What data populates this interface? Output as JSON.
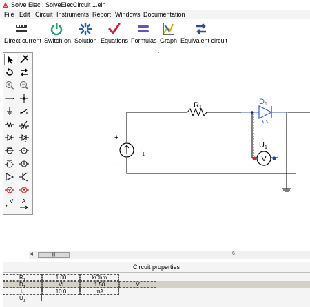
{
  "window": {
    "title": "Solve Elec : SolveElecCircuit 1.eln"
  },
  "menu": [
    "File",
    "Edit",
    "Circuit",
    "Instruments",
    "Report",
    "Windows",
    "Documentation"
  ],
  "toolbar": [
    {
      "label": "Direct current",
      "icon": "battery-icon"
    },
    {
      "label": "Switch on",
      "icon": "power-icon"
    },
    {
      "label": "Solution",
      "icon": "spark-icon"
    },
    {
      "label": "Equations",
      "icon": "check-icon"
    },
    {
      "label": "Formulas",
      "icon": "equals-icon"
    },
    {
      "label": "Graph",
      "icon": "graph-icon"
    },
    {
      "label": "Equivalent circuit",
      "icon": "equivalent-icon"
    }
  ],
  "circuit": {
    "resistor": {
      "name": "R",
      "sub": "1"
    },
    "diode": {
      "name": "D",
      "sub": "1"
    },
    "voltmeter": {
      "name": "U",
      "sub": "1",
      "symbol": "V"
    },
    "source": {
      "name": "I",
      "sub": "1",
      "plus": "+",
      "minus": "−"
    }
  },
  "palette_labels": {
    "voltage": "V",
    "current": "A"
  },
  "properties": {
    "title": "Circuit properties",
    "rows": [
      {
        "name": "R",
        "sub": "1",
        "value": "1.00",
        "unit": "kOhm",
        "extra": "",
        "extra2": ""
      },
      {
        "name": "D",
        "sub": "1",
        "value": "Vl",
        "unit": "1.50",
        "extra": "V",
        "extra2": ""
      },
      {
        "name": "I",
        "sub": "1",
        "value": "10.0",
        "unit": "mA",
        "extra": "",
        "extra2": ""
      },
      {
        "name": "U",
        "sub": "1",
        "value": "",
        "unit": "",
        "extra": "",
        "extra2": ""
      }
    ]
  },
  "scrollbar": {
    "thumb": "|||",
    "marker": "6"
  }
}
